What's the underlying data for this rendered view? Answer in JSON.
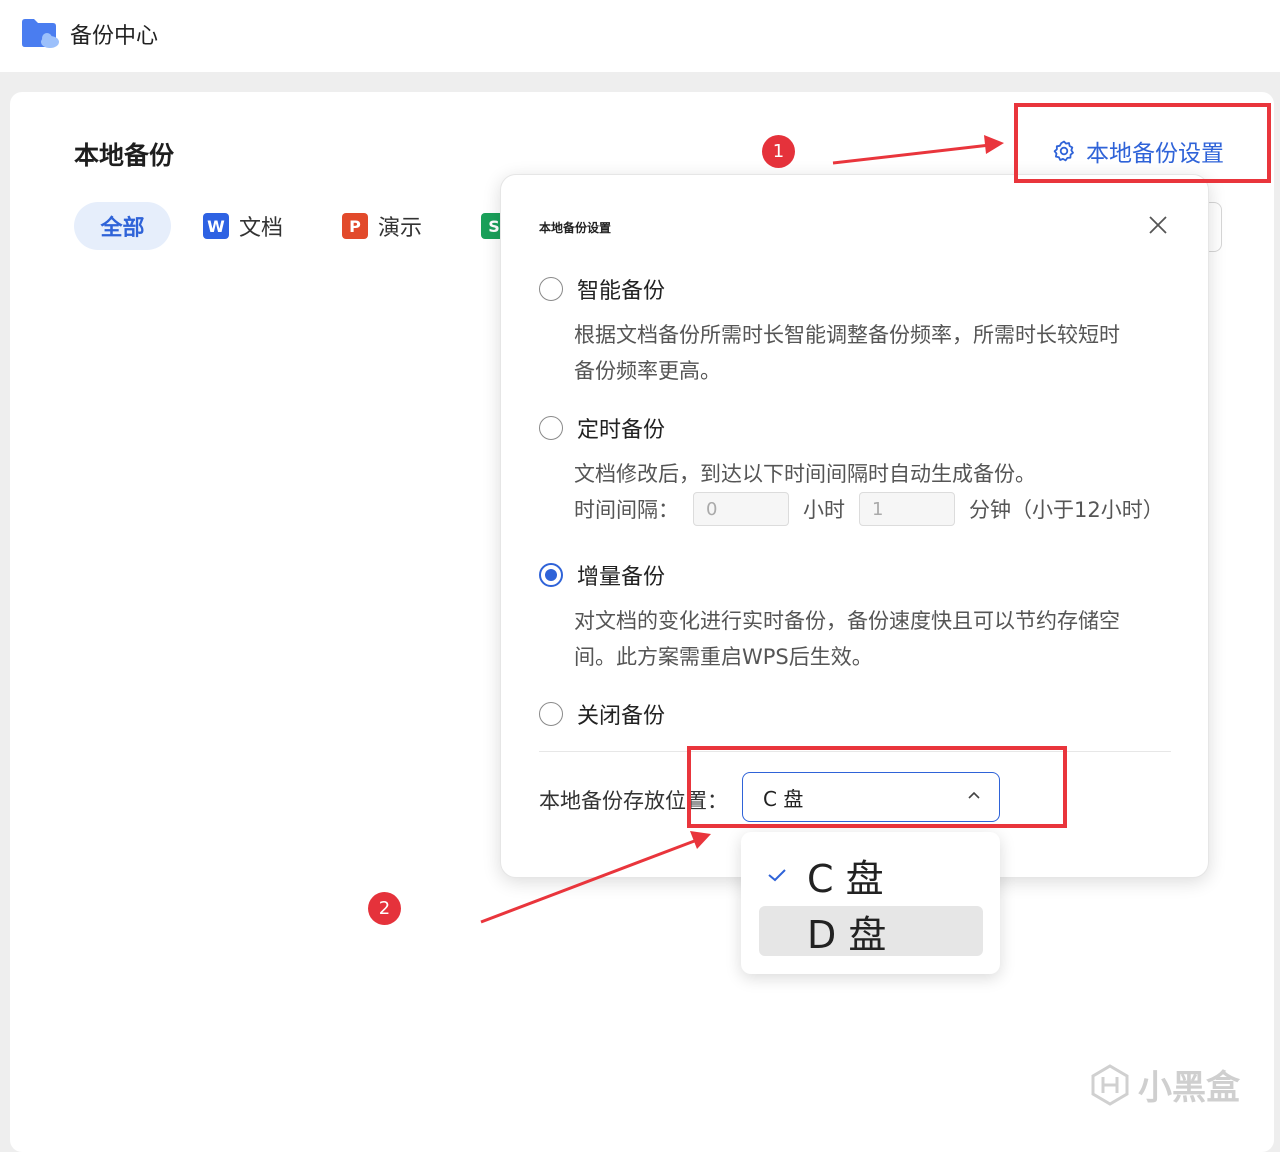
{
  "app": {
    "title": "备份中心"
  },
  "section": {
    "title": "本地备份"
  },
  "tabs": [
    {
      "label": "全部"
    },
    {
      "badge": "W",
      "label": "文档"
    },
    {
      "badge": "P",
      "label": "演示"
    },
    {
      "badge": "S",
      "label": ""
    }
  ],
  "settings_link": {
    "label": "本地备份设置"
  },
  "dialog": {
    "title": "本地备份设置",
    "options": [
      {
        "label": "智能备份",
        "desc_line1": "根据文档备份所需时长智能调整备份频率，所需时长较短时",
        "desc_line2": "备份频率更高。"
      },
      {
        "label": "定时备份",
        "desc_line1": "文档修改后，到达以下时间间隔时自动生成备份。"
      },
      {
        "label": "增量备份",
        "desc_line1": "对文档的变化进行实时备份，备份速度快且可以节约存储空",
        "desc_line2": "间。此方案需重启WPS后生效。"
      },
      {
        "label": "关闭备份"
      }
    ],
    "selected_option": "增量备份",
    "interval": {
      "label": "时间间隔：",
      "hours_value": "0",
      "hours_unit": "小时",
      "minutes_value": "1",
      "minutes_unit": "分钟（小于12小时）"
    },
    "location": {
      "label": "本地备份存放位置：",
      "selected": "C 盘",
      "options": [
        "C 盘",
        "D 盘"
      ]
    }
  },
  "annotations": {
    "step1": "1",
    "step2": "2"
  },
  "watermark": {
    "text": "小黑盒"
  },
  "colors": {
    "accent": "#2f63d8",
    "annotation_red": "#e9353c"
  }
}
